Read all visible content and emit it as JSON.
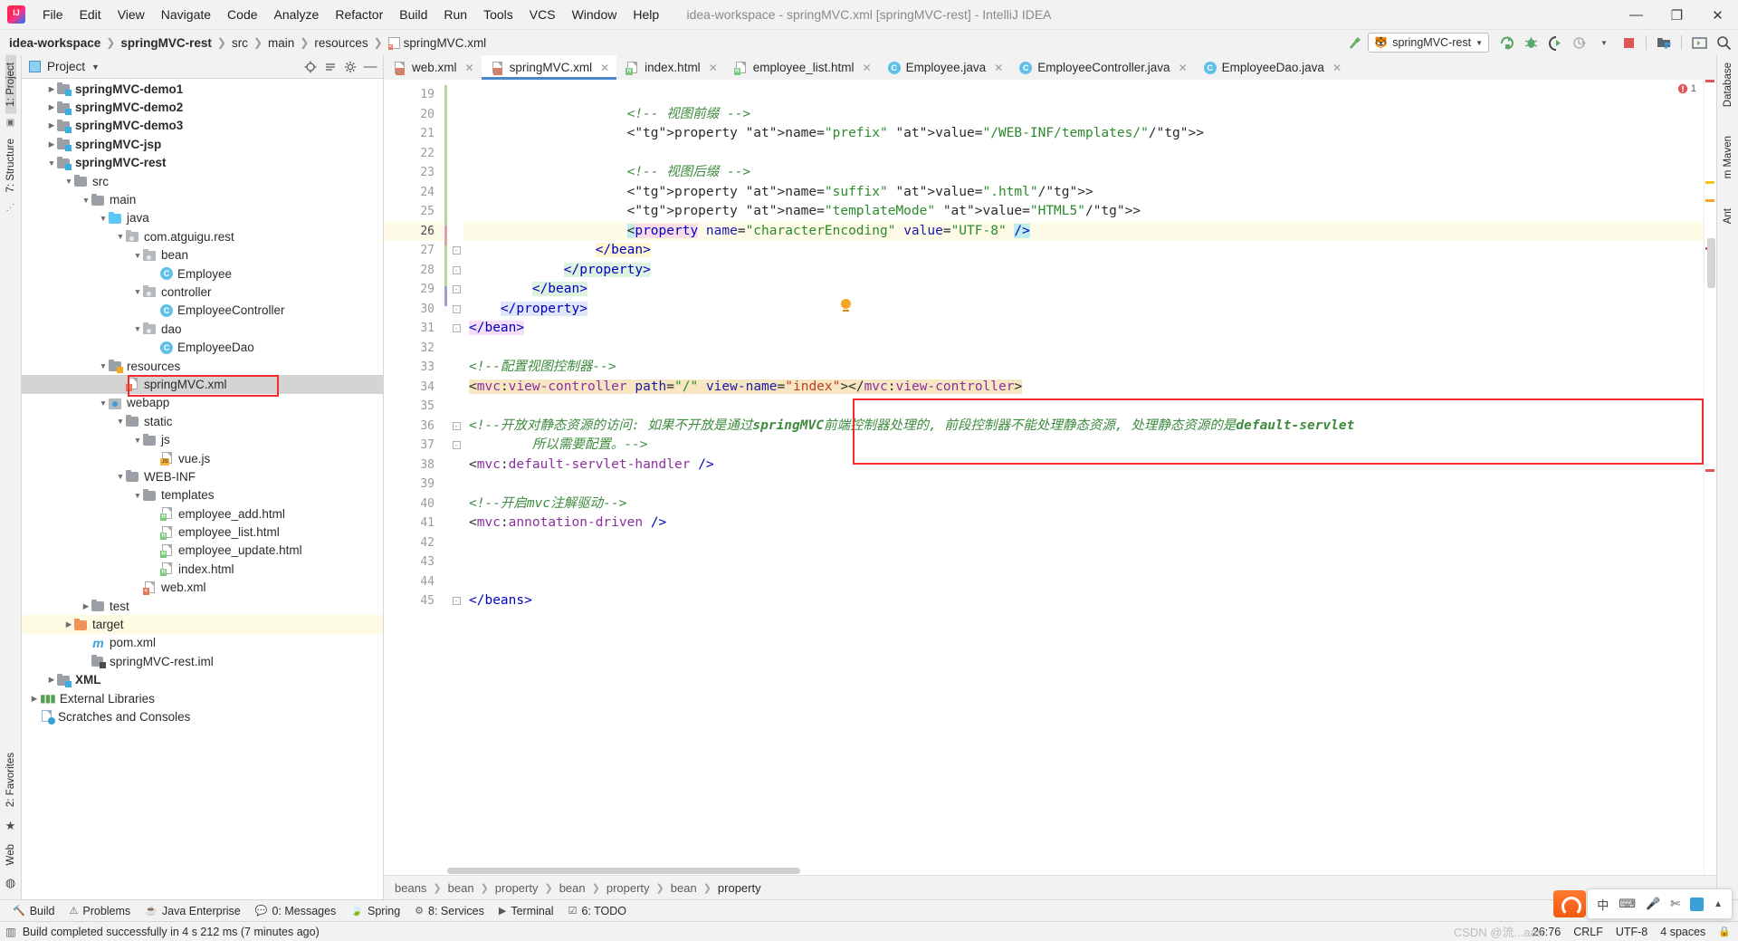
{
  "window": {
    "title": "idea-workspace - springMVC.xml [springMVC-rest] - IntelliJ IDEA",
    "minimize": "—",
    "maximize": "❐",
    "close": "✕"
  },
  "menu": [
    "File",
    "Edit",
    "View",
    "Navigate",
    "Code",
    "Analyze",
    "Refactor",
    "Build",
    "Run",
    "Tools",
    "VCS",
    "Window",
    "Help"
  ],
  "breadcrumb": [
    {
      "label": "idea-workspace",
      "bold": true
    },
    {
      "label": "springMVC-rest",
      "bold": true
    },
    {
      "label": "src",
      "bold": false
    },
    {
      "label": "main",
      "bold": false
    },
    {
      "label": "resources",
      "bold": false
    },
    {
      "label": "springMVC.xml",
      "bold": false,
      "icon": "xml-file-icon"
    }
  ],
  "toolbar": {
    "run_config": "springMVC-rest",
    "icons": [
      "run-icon",
      "debug-icon",
      "run-with-coverage-icon",
      "profile-icon",
      "stop-icon",
      "project-structure-icon",
      "terminal-icon",
      "search-everywhere-icon"
    ]
  },
  "left_strip": {
    "tabs": [
      "1: Project",
      "7: Structure"
    ],
    "bottom_tabs": [
      "2: Favorites",
      "Web"
    ]
  },
  "right_strip": {
    "tabs": [
      "Database",
      "m Maven",
      "Ant"
    ]
  },
  "project_pane": {
    "title": "Project",
    "header_icons": [
      "locate-icon",
      "collapse-all-icon",
      "settings-icon",
      "hide-icon"
    ],
    "tree": [
      {
        "label": "springMVC-demo1",
        "depth": 1,
        "arrow": "collapsed",
        "icon": "module-folder",
        "bold": true
      },
      {
        "label": "springMVC-demo2",
        "depth": 1,
        "arrow": "collapsed",
        "icon": "module-folder",
        "bold": true
      },
      {
        "label": "springMVC-demo3",
        "depth": 1,
        "arrow": "collapsed",
        "icon": "module-folder",
        "bold": true
      },
      {
        "label": "springMVC-jsp",
        "depth": 1,
        "arrow": "collapsed",
        "icon": "module-folder",
        "bold": true
      },
      {
        "label": "springMVC-rest",
        "depth": 1,
        "arrow": "expanded",
        "icon": "module-folder",
        "bold": true
      },
      {
        "label": "src",
        "depth": 2,
        "arrow": "expanded",
        "icon": "folder"
      },
      {
        "label": "main",
        "depth": 3,
        "arrow": "expanded",
        "icon": "folder"
      },
      {
        "label": "java",
        "depth": 4,
        "arrow": "expanded",
        "icon": "source-folder"
      },
      {
        "label": "com.atguigu.rest",
        "depth": 5,
        "arrow": "expanded",
        "icon": "package"
      },
      {
        "label": "bean",
        "depth": 6,
        "arrow": "expanded",
        "icon": "package"
      },
      {
        "label": "Employee",
        "depth": 7,
        "arrow": "none",
        "icon": "java-class"
      },
      {
        "label": "controller",
        "depth": 6,
        "arrow": "expanded",
        "icon": "package"
      },
      {
        "label": "EmployeeController",
        "depth": 7,
        "arrow": "none",
        "icon": "java-class"
      },
      {
        "label": "dao",
        "depth": 6,
        "arrow": "expanded",
        "icon": "package"
      },
      {
        "label": "EmployeeDao",
        "depth": 7,
        "arrow": "none",
        "icon": "java-class"
      },
      {
        "label": "resources",
        "depth": 4,
        "arrow": "expanded",
        "icon": "resource-folder"
      },
      {
        "label": "springMVC.xml",
        "depth": 5,
        "arrow": "none",
        "icon": "xml-file",
        "selected": true,
        "highlight_box": true
      },
      {
        "label": "webapp",
        "depth": 4,
        "arrow": "expanded",
        "icon": "webapp-folder"
      },
      {
        "label": "static",
        "depth": 5,
        "arrow": "expanded",
        "icon": "folder"
      },
      {
        "label": "js",
        "depth": 6,
        "arrow": "expanded",
        "icon": "folder"
      },
      {
        "label": "vue.js",
        "depth": 7,
        "arrow": "none",
        "icon": "js-file"
      },
      {
        "label": "WEB-INF",
        "depth": 5,
        "arrow": "expanded",
        "icon": "folder"
      },
      {
        "label": "templates",
        "depth": 6,
        "arrow": "expanded",
        "icon": "folder"
      },
      {
        "label": "employee_add.html",
        "depth": 7,
        "arrow": "none",
        "icon": "html-file"
      },
      {
        "label": "employee_list.html",
        "depth": 7,
        "arrow": "none",
        "icon": "html-file"
      },
      {
        "label": "employee_update.html",
        "depth": 7,
        "arrow": "none",
        "icon": "html-file"
      },
      {
        "label": "index.html",
        "depth": 7,
        "arrow": "none",
        "icon": "html-file"
      },
      {
        "label": "web.xml",
        "depth": 6,
        "arrow": "none",
        "icon": "xml-file"
      },
      {
        "label": "test",
        "depth": 3,
        "arrow": "collapsed",
        "icon": "folder"
      },
      {
        "label": "target",
        "depth": 2,
        "arrow": "collapsed",
        "icon": "excluded-folder",
        "row_highlight": true
      },
      {
        "label": "pom.xml",
        "depth": 3,
        "arrow": "none",
        "icon": "maven-file"
      },
      {
        "label": "springMVC-rest.iml",
        "depth": 3,
        "arrow": "none",
        "icon": "iml-file"
      },
      {
        "label": "XML",
        "depth": 1,
        "arrow": "collapsed",
        "icon": "module-folder",
        "bold": true
      },
      {
        "label": "External Libraries",
        "depth": 0,
        "arrow": "collapsed",
        "icon": "libraries"
      },
      {
        "label": "Scratches and Consoles",
        "depth": 0,
        "arrow": "none",
        "icon": "scratches"
      }
    ]
  },
  "editor": {
    "tabs": [
      {
        "label": "web.xml",
        "icon": "xml-file-icon",
        "active": false
      },
      {
        "label": "springMVC.xml",
        "icon": "xml-file-icon",
        "active": true
      },
      {
        "label": "index.html",
        "icon": "html-file-icon",
        "active": false
      },
      {
        "label": "employee_list.html",
        "icon": "html-file-icon",
        "active": false
      },
      {
        "label": "Employee.java",
        "icon": "java-class-icon",
        "active": false
      },
      {
        "label": "EmployeeController.java",
        "icon": "java-class-icon",
        "active": false
      },
      {
        "label": "EmployeeDao.java",
        "icon": "java-class-icon",
        "active": false
      }
    ],
    "first_line_number": 19,
    "line_numbers": [
      19,
      20,
      21,
      22,
      23,
      24,
      25,
      26,
      27,
      28,
      29,
      30,
      31,
      32,
      33,
      34,
      35,
      36,
      37,
      38,
      39,
      40,
      41,
      42,
      43,
      44,
      45
    ],
    "current_line": 26,
    "lines": [
      {
        "n": 19,
        "text": ""
      },
      {
        "n": 20,
        "text": "                    <!-- 视图前缀 -->"
      },
      {
        "n": 21,
        "text": "                    <property name=\"prefix\" value=\"/WEB-INF/templates/\"/>"
      },
      {
        "n": 22,
        "text": ""
      },
      {
        "n": 23,
        "text": "                    <!-- 视图后缀 -->"
      },
      {
        "n": 24,
        "text": "                    <property name=\"suffix\" value=\".html\"/>"
      },
      {
        "n": 25,
        "text": "                    <property name=\"templateMode\" value=\"HTML5\"/>"
      },
      {
        "n": 26,
        "text": "                    <property name=\"characterEncoding\" value=\"UTF-8\" />"
      },
      {
        "n": 27,
        "text": "                </bean>"
      },
      {
        "n": 28,
        "text": "            </property>"
      },
      {
        "n": 29,
        "text": "        </bean>"
      },
      {
        "n": 30,
        "text": "    </property>"
      },
      {
        "n": 31,
        "text": "</bean>"
      },
      {
        "n": 32,
        "text": ""
      },
      {
        "n": 33,
        "text": "<!--配置视图控制器-->"
      },
      {
        "n": 34,
        "text": "<mvc:view-controller path=\"/\" view-name=\"index\"></mvc:view-controller>"
      },
      {
        "n": 35,
        "text": ""
      },
      {
        "n": 36,
        "text": "<!--开放对静态资源的访问: 如果不开放是通过springMVC前端控制器处理的, 前段控制器不能处理静态资源, 处理静态资源的是default-servlet"
      },
      {
        "n": 37,
        "text": "        所以需要配置。-->"
      },
      {
        "n": 38,
        "text": "<mvc:default-servlet-handler />"
      },
      {
        "n": 39,
        "text": ""
      },
      {
        "n": 40,
        "text": "<!--开启mvc注解驱动-->"
      },
      {
        "n": 41,
        "text": "<mvc:annotation-driven />"
      },
      {
        "n": 42,
        "text": ""
      },
      {
        "n": 43,
        "text": ""
      },
      {
        "n": 44,
        "text": ""
      },
      {
        "n": 45,
        "text": "</beans>"
      }
    ],
    "breadcrumbs": [
      "beans",
      "bean",
      "property",
      "bean",
      "property",
      "bean",
      "property"
    ],
    "inspection_count": "1"
  },
  "bottom_tool_windows": [
    {
      "label": "Build",
      "icon": "build-icon",
      "mnemonic": ""
    },
    {
      "label": "Problems",
      "icon": "problems-icon",
      "mnemonic": ""
    },
    {
      "label": "Java Enterprise",
      "icon": "java-enterprise-icon",
      "mnemonic": ""
    },
    {
      "label": "0: Messages",
      "icon": "messages-icon",
      "mnemonic": "0"
    },
    {
      "label": "Spring",
      "icon": "spring-icon",
      "mnemonic": ""
    },
    {
      "label": "8: Services",
      "icon": "services-icon",
      "mnemonic": "8"
    },
    {
      "label": "Terminal",
      "icon": "terminal-icon",
      "mnemonic": ""
    },
    {
      "label": "6: TODO",
      "icon": "todo-icon",
      "mnemonic": "6"
    }
  ],
  "status_bar": {
    "message": "Build completed successfully in 4 s 212 ms (7 minutes ago)",
    "caret_position": "26:76",
    "line_separator": "CRLF",
    "encoding": "UTF-8",
    "indent": "4 spaces",
    "watermark": "CSDN @流...aaa"
  },
  "tray": {
    "items": [
      "中",
      "keyboard-icon",
      "microphone-icon",
      "screenshot-icon",
      "toolbox-icon",
      "chevron-up-icon"
    ]
  },
  "colors": {
    "accent": "#4a86c8",
    "red_box": "#f22c2c",
    "comment_green": "#3e8a3e",
    "tag_blue": "#0000c0",
    "string_green": "#2b8a2b",
    "ns_purple": "#8c2fa0",
    "selection_gray": "#d4d4d4"
  }
}
